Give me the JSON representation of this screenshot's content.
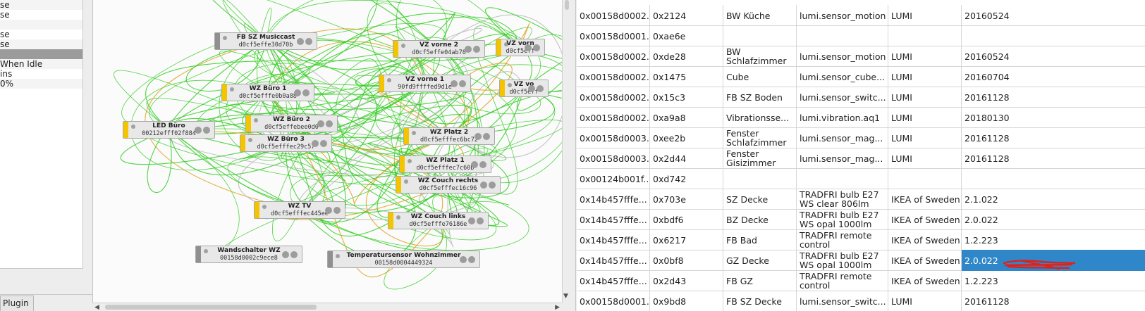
{
  "left_panel": {
    "rows": [
      {
        "text": "se",
        "style": "alt"
      },
      {
        "text": "se",
        "style": ""
      },
      {
        "text": "",
        "style": "alt"
      },
      {
        "text": "se",
        "style": ""
      },
      {
        "text": "se",
        "style": "alt"
      },
      {
        "text": "",
        "style": "sel"
      },
      {
        "text": " When Idle",
        "style": "alt"
      },
      {
        "text": "ins",
        "style": ""
      },
      {
        "text": "0%",
        "style": "alt"
      }
    ],
    "plugin_tab": "Plugin"
  },
  "graph": {
    "nodes": [
      {
        "name": "FB SZ Musiccast",
        "addr": "d0cf5effe30d70b",
        "color": "gray"
      },
      {
        "name": "VZ vorne 2",
        "addr": "d0cf5effe04ab78",
        "color": "yellow"
      },
      {
        "name": "VZ vorn",
        "addr": "d0cf5eff",
        "color": "yellow"
      },
      {
        "name": "VZ vorne 1",
        "addr": "90fd9ffffed9d1e",
        "color": "yellow"
      },
      {
        "name": "VZ vo",
        "addr": "d0cf5eff",
        "color": "yellow"
      },
      {
        "name": "WZ Büro 1",
        "addr": "d0cf5efffe0b0a88",
        "color": "yellow"
      },
      {
        "name": "WZ Büro 2",
        "addr": "d0cf5effebee0d0",
        "color": "yellow"
      },
      {
        "name": "LED Büro",
        "addr": "00212efff02f884",
        "color": "yellow"
      },
      {
        "name": "WZ Büro 3",
        "addr": "d0cf5efffec29c57",
        "color": "yellow"
      },
      {
        "name": "WZ Platz 2",
        "addr": "d0cf5efffec6bc72",
        "color": "yellow"
      },
      {
        "name": "WZ Platz 1",
        "addr": "d0cf5efffec7c60b",
        "color": "yellow"
      },
      {
        "name": "WZ Couch rechts",
        "addr": "d0cf5efffec16c96",
        "color": "yellow"
      },
      {
        "name": "WZ TV",
        "addr": "d0cf5efffec445ee",
        "color": "yellow"
      },
      {
        "name": "WZ Couch links",
        "addr": "d0cf5efffe76186e",
        "color": "yellow"
      },
      {
        "name": "Wandschalter WZ",
        "addr": "00158d0002c9ece8",
        "color": "gray"
      },
      {
        "name": "Temperatursensor Wohnzimmer",
        "addr": "00158d0004449324",
        "color": "gray"
      }
    ]
  },
  "table": {
    "rows": [
      {
        "cells": [
          "0x00158d0002...",
          "0x2124",
          "BW Küche",
          "lumi.sensor_motion",
          "LUMI",
          "20160524"
        ]
      },
      {
        "cells": [
          "0x00158d0001...",
          "0xae6e",
          "",
          "",
          "",
          ""
        ]
      },
      {
        "cells": [
          "0x00158d0002...",
          "0xde28",
          "BW Schlafzimmer",
          "lumi.sensor_motion",
          "LUMI",
          "20160524"
        ]
      },
      {
        "cells": [
          "0x00158d0002...",
          "0x1475",
          "Cube",
          "lumi.sensor_cube...",
          "LUMI",
          "20160704"
        ]
      },
      {
        "cells": [
          "0x00158d0002...",
          "0x15c3",
          "FB SZ Boden",
          "lumi.sensor_switc...",
          "LUMI",
          "20161128"
        ]
      },
      {
        "cells": [
          "0x00158d0002...",
          "0xa9a8",
          "Vibrationsse...",
          "lumi.vibration.aq1",
          "LUMI",
          "20180130"
        ]
      },
      {
        "cells": [
          "0x00158d0003...",
          "0xee2b",
          "Fenster Schlafzimmer",
          "lumi.sensor_mag...",
          "LUMI",
          "20161128"
        ]
      },
      {
        "cells": [
          "0x00158d0003...",
          "0x2d44",
          "Fenster Gisizimmer",
          "lumi.sensor_mag...",
          "LUMI",
          "20161128"
        ]
      },
      {
        "cells": [
          "0x00124b001f...",
          "0xd742",
          "",
          "",
          "",
          ""
        ]
      },
      {
        "cells": [
          "0x14b457fffe...",
          "0x703e",
          "SZ Decke",
          "TRADFRI bulb E27 WS clear 806lm",
          "IKEA of Sweden",
          "2.1.022"
        ]
      },
      {
        "cells": [
          "0x14b457fffe...",
          "0xbdf6",
          "BZ Decke",
          "TRADFRI bulb E27 WS opal 1000lm",
          "IKEA of Sweden",
          "2.0.022"
        ]
      },
      {
        "cells": [
          "0x14b457fffe...",
          "0x6217",
          "FB Bad",
          "TRADFRI remote control",
          "IKEA of Sweden",
          "1.2.223"
        ]
      },
      {
        "cells": [
          "0x14b457fffe...",
          "0x0bf8",
          "GZ Decke",
          "TRADFRI bulb E27 WS opal 1000lm",
          "IKEA of Sweden",
          "2.0.022"
        ],
        "selected_col": 5
      },
      {
        "cells": [
          "0x14b457fffe...",
          "0x2d43",
          "FB GZ",
          "TRADFRI remote control",
          "IKEA of Sweden",
          "1.2.223"
        ]
      },
      {
        "cells": [
          "0x00158d0001...",
          "0x9bd8",
          "FB SZ Decke",
          "lumi.sensor_switc...",
          "LUMI",
          "20161128"
        ]
      }
    ],
    "selection_color": "#2f87c9",
    "annotation_color": "#e0201a"
  },
  "colors": {
    "edge_green": "#33cc22",
    "edge_gray": "#bbbbbb",
    "edge_orange": "#e0a020",
    "node_bar": "#f5c400"
  }
}
